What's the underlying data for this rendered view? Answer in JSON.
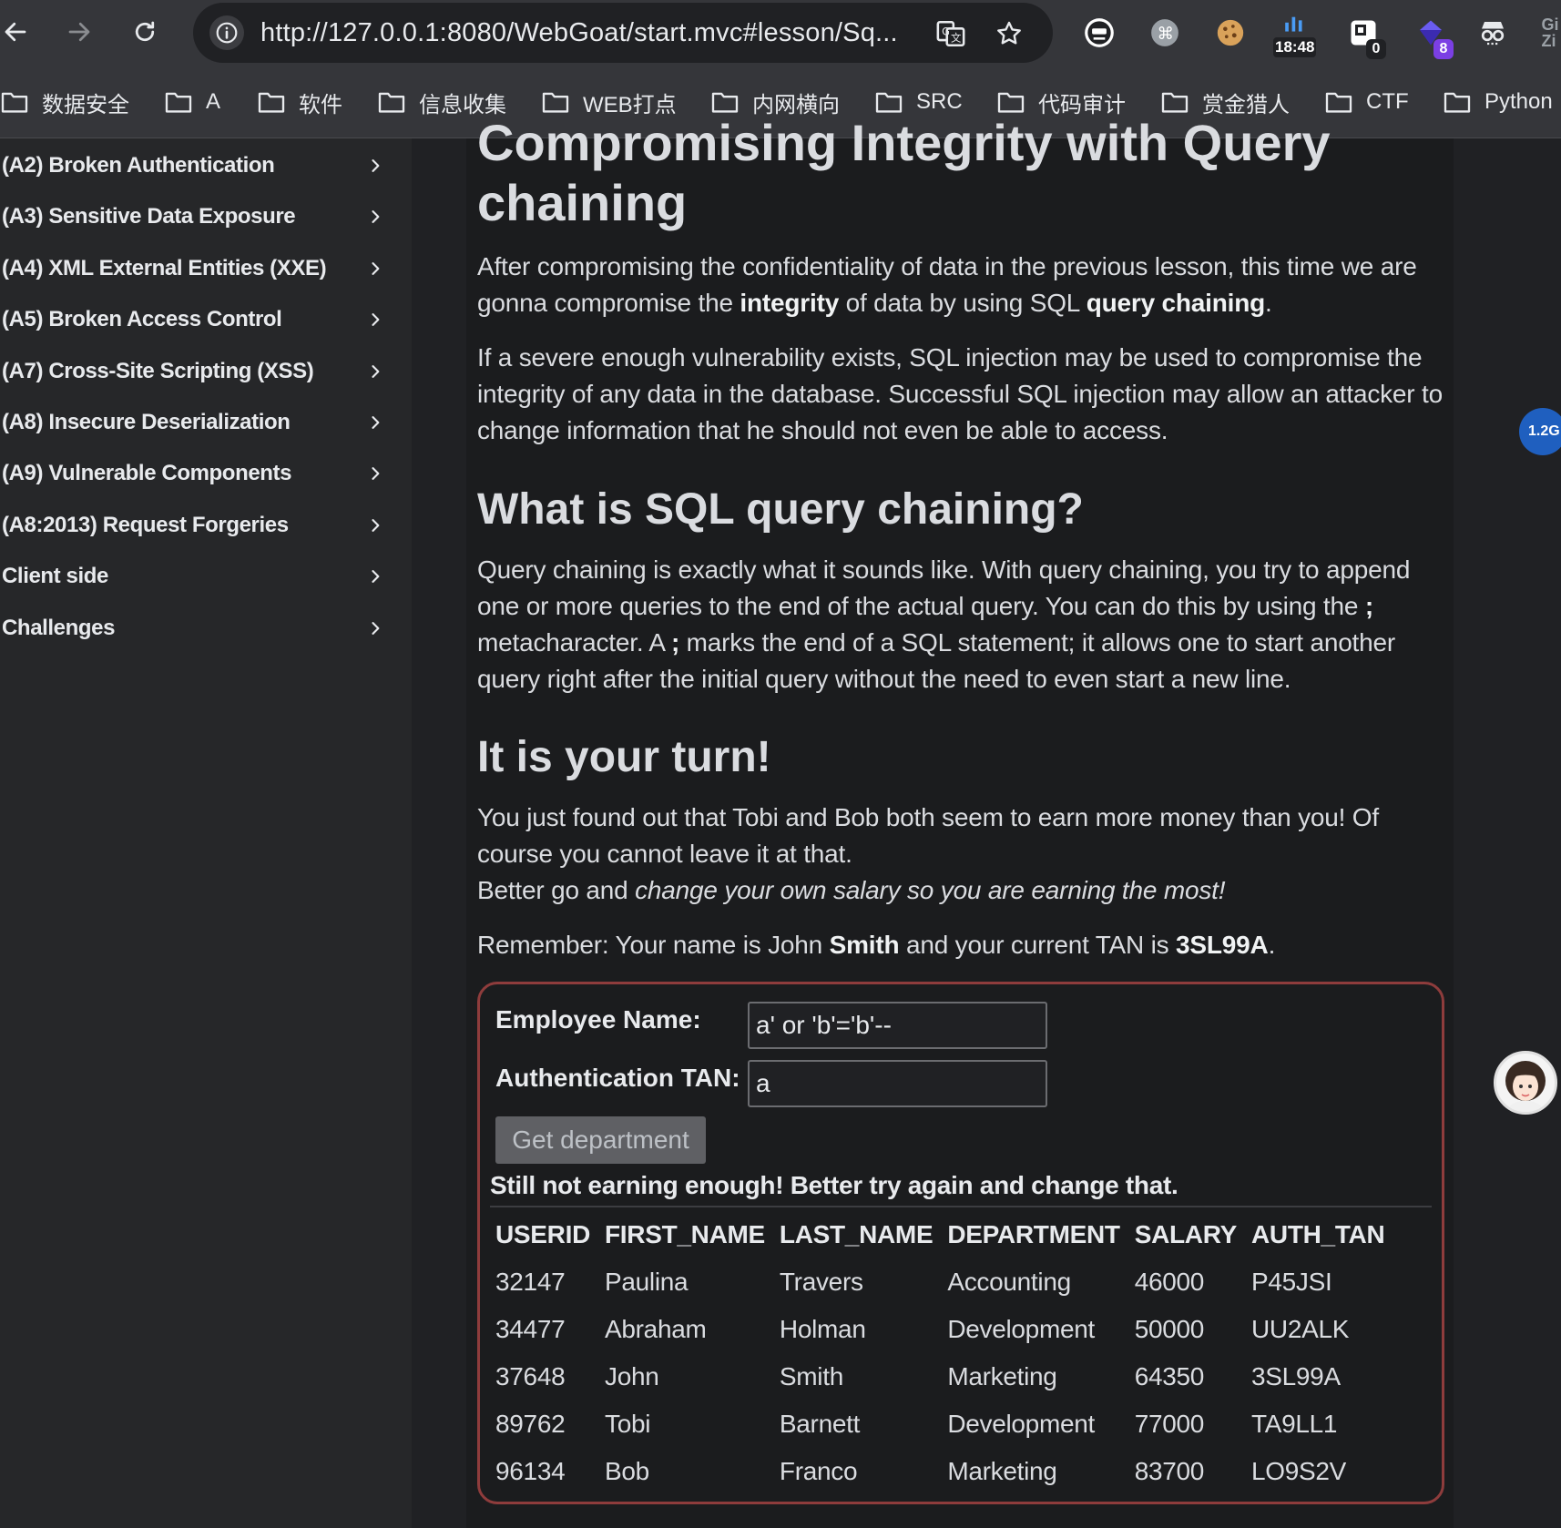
{
  "browser": {
    "url": "http://127.0.0.1:8080/WebGoat/start.mvc#lesson/Sq...",
    "ext_time": "18:48",
    "ext_badge_zero": "0",
    "ext_badge_eight": "8",
    "edge_text": "Gi\nZi"
  },
  "bookmarks": [
    "数据安全",
    "A",
    "软件",
    "信息收集",
    "WEB打点",
    "内网横向",
    "SRC",
    "代码审计",
    "赏金猎人",
    "CTF",
    "Python"
  ],
  "sidebar": {
    "items": [
      "(A2) Broken Authentication",
      "(A3) Sensitive Data Exposure",
      "(A4) XML External Entities (XXE)",
      "(A5) Broken Access Control",
      "(A7) Cross-Site Scripting (XSS)",
      "(A8) Insecure Deserialization",
      "(A9) Vulnerable Components",
      "(A8:2013) Request Forgeries",
      "Client side",
      "Challenges"
    ]
  },
  "lesson": {
    "title_line1": "Compromising Integrity with Query",
    "title_line2": "chaining",
    "intro_pre": "After compromising the confidentiality of data in the previous lesson, this time we are gonna compromise the ",
    "intro_bold1": "integrity",
    "intro_mid": " of data by using SQL ",
    "intro_bold2": "query chaining",
    "intro_end": ".",
    "para2": "If a severe enough vulnerability exists, SQL injection may be used to compromise the integrity of any data in the database. Successful SQL injection may allow an attacker to change information that he should not even be able to access.",
    "h2_chaining": "What is SQL query chaining?",
    "chain_pre": "Query chaining is exactly what it sounds like. With query chaining, you try to append one or more queries to the end of the actual query. You can do this by using the ",
    "chain_semi1": ";",
    "chain_mid": " metacharacter. A ",
    "chain_semi2": ";",
    "chain_end": " marks the end of a SQL statement; it allows one to start another query right after the initial query without the need to even start a new line.",
    "h2_turn": "It is your turn!",
    "turn_line1": "You just found out that Tobi and Bob both seem to earn more money than you! Of course you cannot leave it at that.",
    "turn_line2_pre": "Better go and ",
    "turn_line2_em": "change your own salary so you are earning the most!",
    "remember_pre": "Remember: Your name is John ",
    "remember_name": "Smith",
    "remember_mid": " and your current TAN is ",
    "remember_tan": "3SL99A",
    "remember_end": "."
  },
  "form": {
    "name_label": "Employee Name:",
    "name_value": "a' or 'b'='b'--",
    "tan_label": "Authentication TAN:",
    "tan_value": "a",
    "submit_label": "Get department",
    "feedback": "Still not earning enough! Better try again and change that."
  },
  "results": {
    "columns": [
      "USERID",
      "FIRST_NAME",
      "LAST_NAME",
      "DEPARTMENT",
      "SALARY",
      "AUTH_TAN"
    ],
    "rows": [
      [
        "32147",
        "Paulina",
        "Travers",
        "Accounting",
        "46000",
        "P45JSI"
      ],
      [
        "34477",
        "Abraham",
        "Holman",
        "Development",
        "50000",
        "UU2ALK"
      ],
      [
        "37648",
        "John",
        "Smith",
        "Marketing",
        "64350",
        "3SL99A"
      ],
      [
        "89762",
        "Tobi",
        "Barnett",
        "Development",
        "77000",
        "TA9LL1"
      ],
      [
        "96134",
        "Bob",
        "Franco",
        "Marketing",
        "83700",
        "LO9S2V"
      ]
    ]
  },
  "widgets": {
    "float_badge": "1.2G"
  },
  "colors": {
    "panel_border": "#8e3c3c",
    "float_badge": "#1f5fbf"
  }
}
